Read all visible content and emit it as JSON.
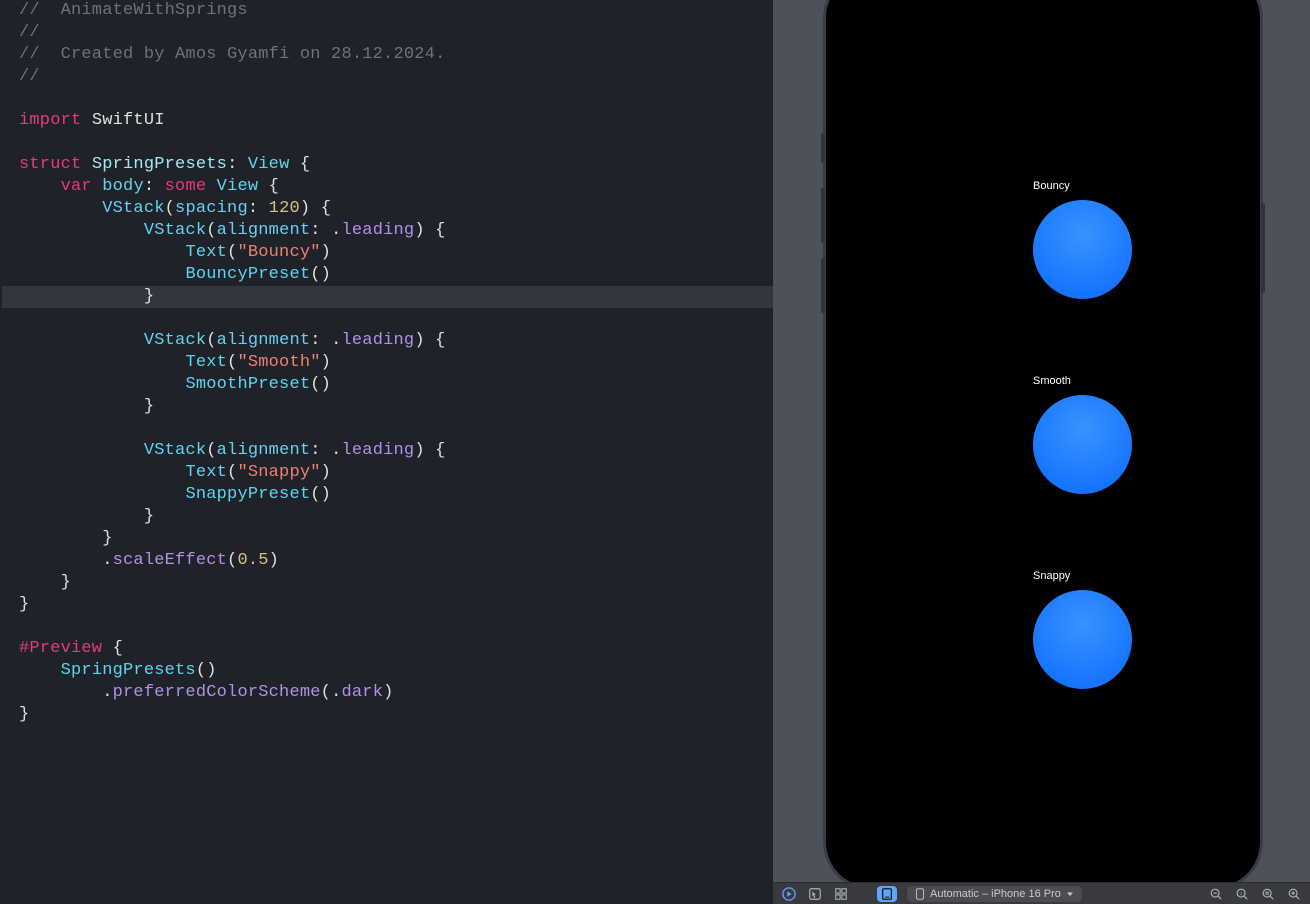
{
  "code": {
    "comment_project": "//  AnimateWithSprings",
    "comment_empty1": "//",
    "comment_created": "//  Created by Amos Gyamfi on 28.12.2024.",
    "comment_empty2": "//",
    "import_kw": "import",
    "import_mod": "SwiftUI",
    "struct_kw": "struct",
    "struct_name": "SpringPresets",
    "view_type": "View",
    "var_kw": "var",
    "body_prop": "body",
    "some_kw": "some",
    "vstack": "VStack",
    "spacing_param": "spacing",
    "spacing_val": "120",
    "alignment_param": "alignment",
    "leading_val": "leading",
    "text_fn": "Text",
    "bouncy_str": "\"Bouncy\"",
    "bouncy_preset": "BouncyPreset",
    "smooth_str": "\"Smooth\"",
    "smooth_preset": "SmoothPreset",
    "snappy_str": "\"Snappy\"",
    "snappy_preset": "SnappyPreset",
    "scale_effect": "scaleEffect",
    "scale_val": "0.5",
    "preview_kw": "#Preview",
    "spring_presets_call": "SpringPresets",
    "preferred_color": "preferredColorScheme",
    "dark_val": "dark"
  },
  "preview": {
    "labels": {
      "bouncy": "Bouncy",
      "smooth": "Smooth",
      "snappy": "Snappy"
    }
  },
  "toolbar": {
    "device": "Automatic – iPhone 16 Pro"
  }
}
